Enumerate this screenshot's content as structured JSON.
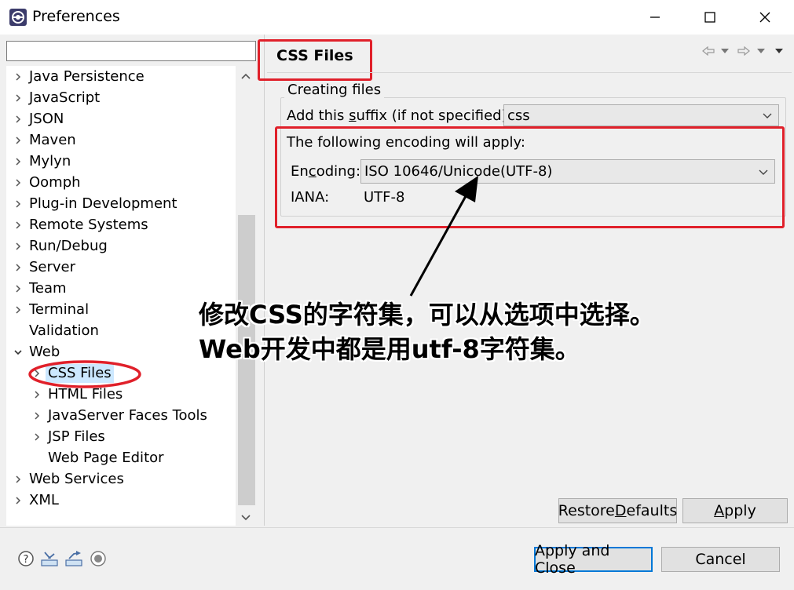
{
  "window": {
    "title": "Preferences",
    "minimize": "—",
    "maximize": "☐",
    "close": "✕"
  },
  "tree": {
    "filter_value": "",
    "items": [
      {
        "label": "Java Persistence"
      },
      {
        "label": "JavaScript"
      },
      {
        "label": "JSON"
      },
      {
        "label": "Maven"
      },
      {
        "label": "Mylyn"
      },
      {
        "label": "Oomph"
      },
      {
        "label": "Plug-in Development"
      },
      {
        "label": "Remote Systems"
      },
      {
        "label": "Run/Debug"
      },
      {
        "label": "Server"
      },
      {
        "label": "Team"
      },
      {
        "label": "Terminal"
      },
      {
        "label": "Validation"
      },
      {
        "label": "Web"
      },
      {
        "label": "CSS Files"
      },
      {
        "label": "HTML Files"
      },
      {
        "label": "JavaServer Faces Tools"
      },
      {
        "label": "JSP Files"
      },
      {
        "label": "Web Page Editor"
      },
      {
        "label": "Web Services"
      },
      {
        "label": "XML"
      }
    ]
  },
  "page": {
    "title": "CSS Files",
    "group_label": "Creating files",
    "suffix_label_pre": "Add this ",
    "suffix_label_mnemonic": "s",
    "suffix_label_post": "uffix (if not specified):",
    "suffix_value": "css",
    "encoding_heading": "The following encoding will apply:",
    "encoding_label_pre": "En",
    "encoding_label_mnemonic": "c",
    "encoding_label_post": "oding:",
    "encoding_value": "ISO 10646/Unicode(UTF-8)",
    "iana_label": "IANA:",
    "iana_value": "UTF-8"
  },
  "buttons": {
    "restore_pre": "Restore ",
    "restore_mnemonic": "D",
    "restore_post": "efaults",
    "apply_mnemonic": "A",
    "apply_post": "pply",
    "apply_close": "Apply and Close",
    "cancel": "Cancel"
  },
  "annotation": {
    "line1": "修改CSS的字符集，可以从选项中选择。",
    "line2": "Web开发中都是用utf-8字符集。"
  },
  "colors": {
    "highlight_red": "#e0202a",
    "selection": "#cce8ff",
    "primary_border": "#0078d7"
  }
}
